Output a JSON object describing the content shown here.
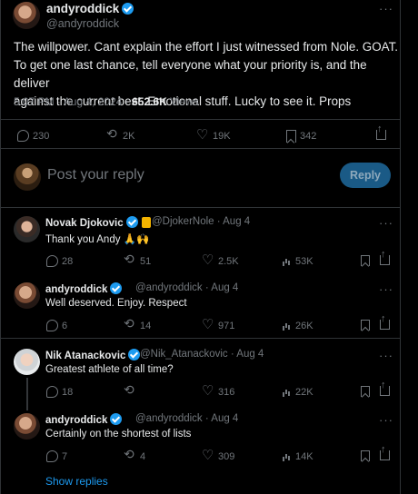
{
  "main_tweet": {
    "author_name": "andyroddick",
    "author_handle": "@andyroddick",
    "text_lines": [
      "The willpower.  Cant explain the effort I just witnessed from Nole. GOAT.",
      "To get one last chance, tell everyone what your priority is, and the deliver",
      "against the current best. Emotional stuff.  Lucky to see it.  Props"
    ],
    "time": "5:07 PM · Aug 4, 2024 ·",
    "views_count": "652.6K",
    "views_label": "Views",
    "stats": {
      "replies": "230",
      "retweets": "2K",
      "likes": "19K",
      "bookmarks": "342"
    }
  },
  "composer": {
    "placeholder": "Post your reply",
    "button_label": "Reply"
  },
  "replies": [
    {
      "name": "Novak Djokovic",
      "handle": "@DjokerNole · Aug 4",
      "text": "Thank you Andy 🙏🙌",
      "replies": "28",
      "retweets": "51",
      "likes": "2.5K",
      "views": "53K"
    },
    {
      "name": "andyroddick",
      "handle": "@andyroddick · Aug 4",
      "text": "Well deserved. Enjoy. Respect",
      "replies": "6",
      "retweets": "14",
      "likes": "971",
      "views": "26K"
    },
    {
      "name": "Nik Atanackovic",
      "handle": "@Nik_Atanackovic · Aug 4",
      "text": "Greatest athlete of all time?",
      "replies": "18",
      "retweets": "",
      "likes": "316",
      "views": "22K"
    },
    {
      "name": "andyroddick",
      "handle": "@andyroddick · Aug 4",
      "text": "Certainly on the shortest of lists",
      "replies": "7",
      "retweets": "4",
      "likes": "309",
      "views": "14K"
    }
  ],
  "show_replies": "Show replies",
  "more_label": "···",
  "colors": {
    "accent": "#1d9bf0",
    "background": "#000000",
    "divider": "#2f3336",
    "muted": "#71767b"
  }
}
